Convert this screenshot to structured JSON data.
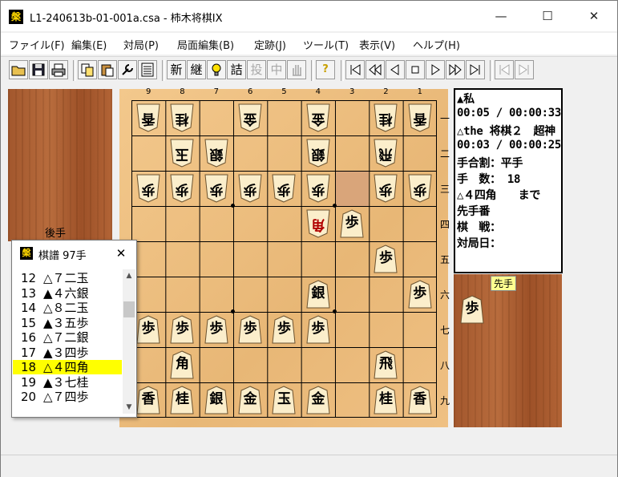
{
  "window": {
    "title": "L1-240613b-01-001a.csa - 柿木将棋IX",
    "app_icon": "槃",
    "minimize": "—",
    "maximize": "☐",
    "close": "✕"
  },
  "menu": [
    "ファイル(F)",
    "編集(E)",
    "対局(P)",
    "局面編集(B)",
    "定跡(J)",
    "ツール(T)",
    "表示(V)",
    "ヘルプ(H)"
  ],
  "toolbar": {
    "open_icon": "folder-open-icon",
    "save_icon": "save-icon",
    "print_icon": "printer-icon",
    "copy_icon": "copy-icon",
    "paste_icon": "paste-icon",
    "settings_icon": "wrench-icon",
    "list_icon": "list-icon",
    "new": "新",
    "continue": "継",
    "hint": "💡",
    "tsume": "詰",
    "resign": "投",
    "interrupt": "中",
    "hand_icon": "hand-icon",
    "help": "?",
    "nav_first": "|◁",
    "nav_back10": "◁◁",
    "nav_back": "◁",
    "nav_stop": "▢",
    "nav_forward": "▷",
    "nav_forward10": "▷▷",
    "nav_last": "▷|",
    "nav_branch_back": "◁",
    "nav_branch_forward": "▷"
  },
  "board": {
    "files": [
      "9",
      "8",
      "7",
      "6",
      "5",
      "4",
      "3",
      "2",
      "1"
    ],
    "ranks": [
      "一",
      "二",
      "三",
      "四",
      "五",
      "六",
      "七",
      "八",
      "九"
    ],
    "highlight_square": "33",
    "pieces": [
      {
        "sq": "91",
        "ch": "香",
        "owner": "gote"
      },
      {
        "sq": "81",
        "ch": "桂",
        "owner": "gote"
      },
      {
        "sq": "61",
        "ch": "金",
        "owner": "gote"
      },
      {
        "sq": "41",
        "ch": "金",
        "owner": "gote"
      },
      {
        "sq": "21",
        "ch": "桂",
        "owner": "gote"
      },
      {
        "sq": "11",
        "ch": "香",
        "owner": "gote"
      },
      {
        "sq": "82",
        "ch": "玉",
        "owner": "gote"
      },
      {
        "sq": "72",
        "ch": "銀",
        "owner": "gote"
      },
      {
        "sq": "42",
        "ch": "銀",
        "owner": "gote"
      },
      {
        "sq": "22",
        "ch": "飛",
        "owner": "gote"
      },
      {
        "sq": "93",
        "ch": "歩",
        "owner": "gote"
      },
      {
        "sq": "83",
        "ch": "歩",
        "owner": "gote"
      },
      {
        "sq": "73",
        "ch": "歩",
        "owner": "gote"
      },
      {
        "sq": "63",
        "ch": "歩",
        "owner": "gote"
      },
      {
        "sq": "53",
        "ch": "歩",
        "owner": "gote"
      },
      {
        "sq": "43",
        "ch": "歩",
        "owner": "gote"
      },
      {
        "sq": "23",
        "ch": "歩",
        "owner": "gote"
      },
      {
        "sq": "13",
        "ch": "歩",
        "owner": "gote"
      },
      {
        "sq": "44",
        "ch": "角",
        "owner": "gote",
        "last": true
      },
      {
        "sq": "34",
        "ch": "歩",
        "owner": "sente"
      },
      {
        "sq": "25",
        "ch": "歩",
        "owner": "sente"
      },
      {
        "sq": "46",
        "ch": "銀",
        "owner": "sente"
      },
      {
        "sq": "16",
        "ch": "歩",
        "owner": "sente"
      },
      {
        "sq": "97",
        "ch": "歩",
        "owner": "sente"
      },
      {
        "sq": "87",
        "ch": "歩",
        "owner": "sente"
      },
      {
        "sq": "77",
        "ch": "歩",
        "owner": "sente"
      },
      {
        "sq": "67",
        "ch": "歩",
        "owner": "sente"
      },
      {
        "sq": "57",
        "ch": "歩",
        "owner": "sente"
      },
      {
        "sq": "47",
        "ch": "歩",
        "owner": "sente"
      },
      {
        "sq": "88",
        "ch": "角",
        "owner": "sente"
      },
      {
        "sq": "28",
        "ch": "飛",
        "owner": "sente"
      },
      {
        "sq": "99",
        "ch": "香",
        "owner": "sente"
      },
      {
        "sq": "89",
        "ch": "桂",
        "owner": "sente"
      },
      {
        "sq": "79",
        "ch": "銀",
        "owner": "sente"
      },
      {
        "sq": "69",
        "ch": "金",
        "owner": "sente"
      },
      {
        "sq": "59",
        "ch": "玉",
        "owner": "sente"
      },
      {
        "sq": "49",
        "ch": "金",
        "owner": "sente"
      },
      {
        "sq": "29",
        "ch": "桂",
        "owner": "sente"
      },
      {
        "sq": "19",
        "ch": "香",
        "owner": "sente"
      }
    ]
  },
  "sente_hand": {
    "label": "先手",
    "pieces": [
      "歩"
    ]
  },
  "gote_hand": {
    "label": "後手",
    "pieces": []
  },
  "info": {
    "lines": [
      "▲私",
      "00:05 / 00:00:33",
      "△the 将棋２　超神",
      "00:03 / 00:00:25",
      "手合割：平手",
      "手　数： 18",
      "△４四角　　まで",
      "先手番",
      "棋　戦：",
      "対局日："
    ]
  },
  "kifu": {
    "title": "棋譜 97手",
    "icon": "槃",
    "close": "✕",
    "selected_index": 6,
    "moves": [
      {
        "num": "12",
        "mv": "△７二玉"
      },
      {
        "num": "13",
        "mv": "▲４六銀"
      },
      {
        "num": "14",
        "mv": "△８二玉"
      },
      {
        "num": "15",
        "mv": "▲３五歩"
      },
      {
        "num": "16",
        "mv": "△７二銀"
      },
      {
        "num": "17",
        "mv": "▲３四歩"
      },
      {
        "num": "18",
        "mv": "△４四角"
      },
      {
        "num": "19",
        "mv": "▲３七桂"
      },
      {
        "num": "20",
        "mv": "△７四歩"
      }
    ],
    "scroll_up": "▲",
    "scroll_down": "▼"
  }
}
